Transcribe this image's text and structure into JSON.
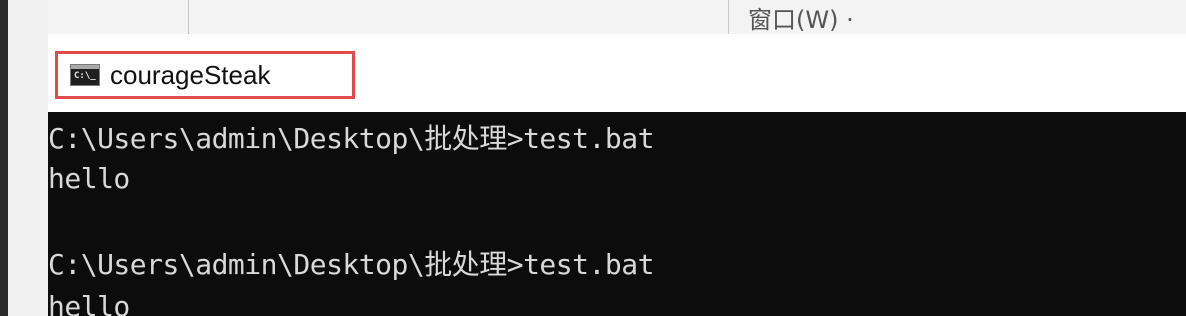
{
  "background_window": {
    "menu_fragment": "窗口(W)   ·"
  },
  "console_window": {
    "title": "courageSteak",
    "icon": "cmd-icon",
    "icon_glyph": "C:\\_",
    "highlight_color": "#e14b4b"
  },
  "terminal": {
    "lines": [
      "C:\\Users\\admin\\Desktop\\批处理>test.bat",
      "hello",
      "",
      "C:\\Users\\admin\\Desktop\\批处理>test.bat",
      "hello"
    ],
    "background_color": "#0c0c0c",
    "text_color": "#d8d8d8"
  }
}
